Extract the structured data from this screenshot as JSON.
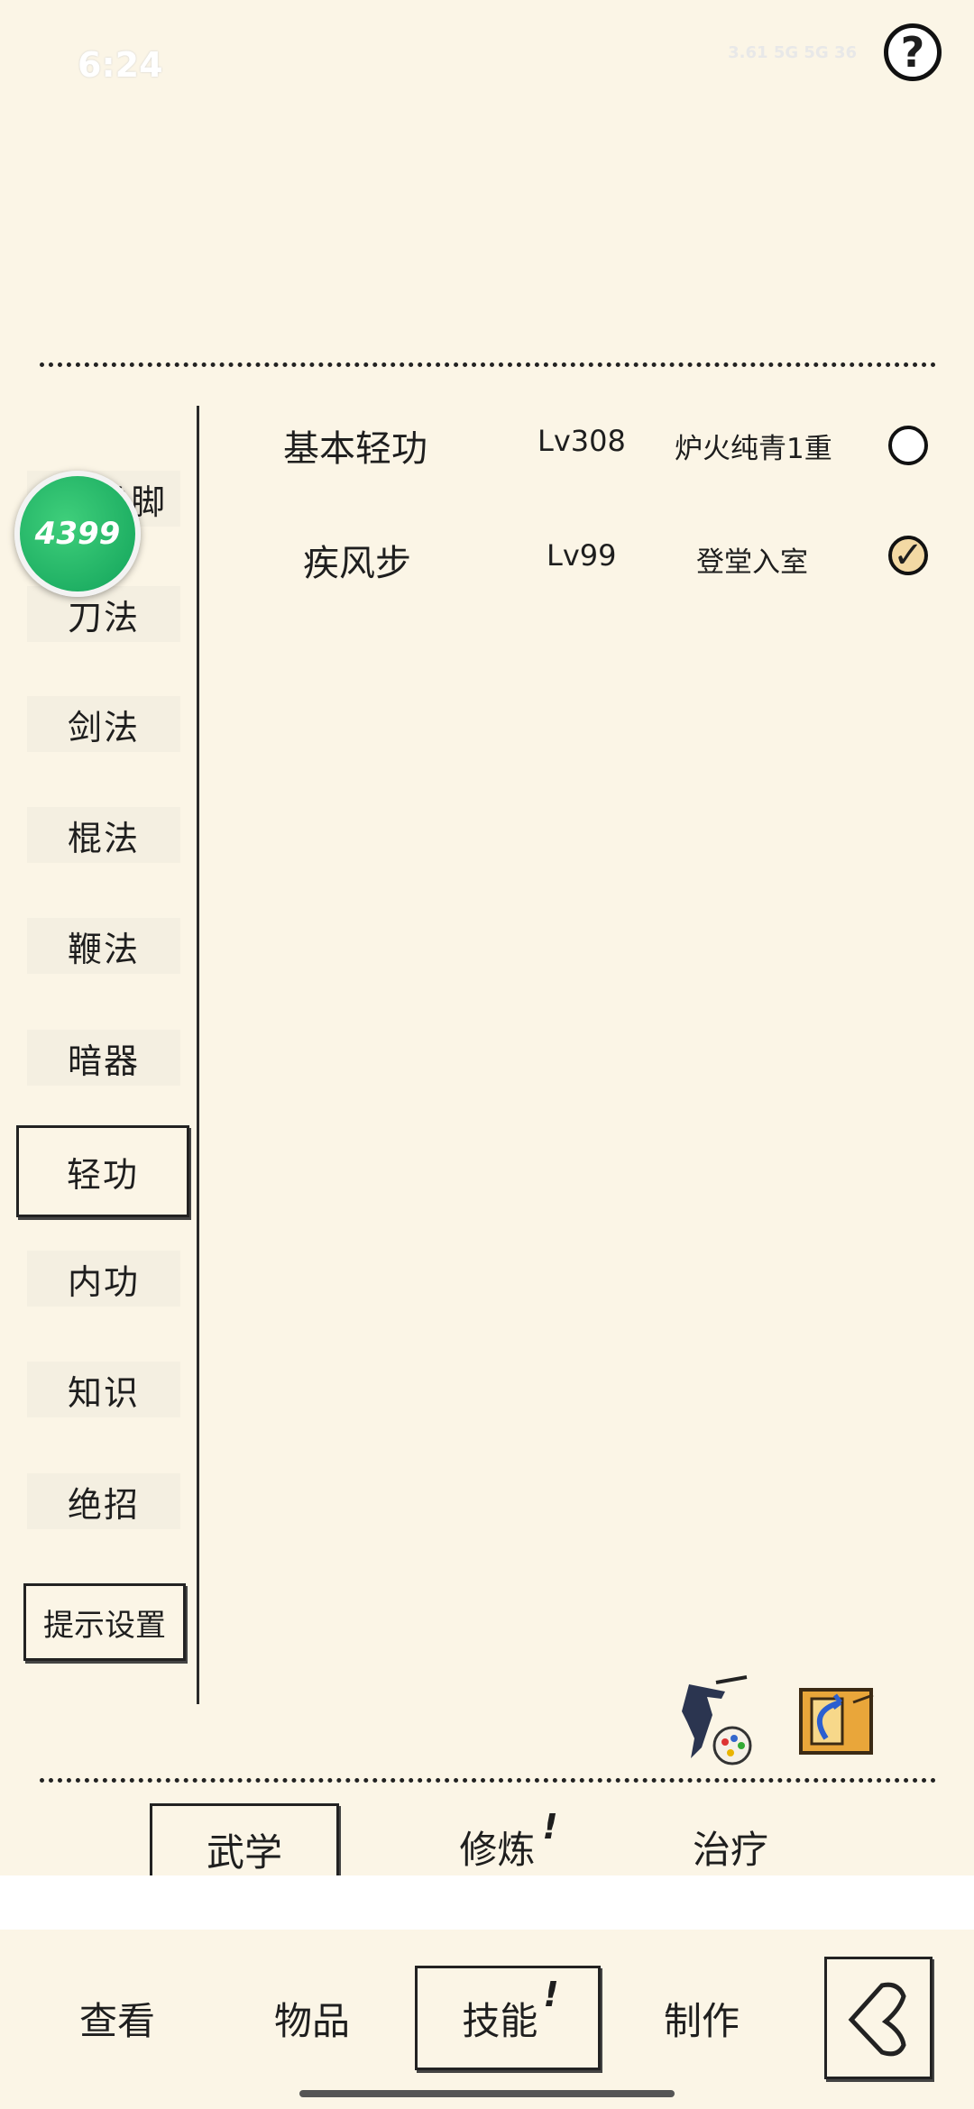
{
  "status": {
    "time": "6:24",
    "signal_text": "3.61 5G  5G  36"
  },
  "help": {
    "label": "?"
  },
  "logo": {
    "text": "4399"
  },
  "sidebar": {
    "items": [
      {
        "label": "拳脚"
      },
      {
        "label": "刀法"
      },
      {
        "label": "剑法"
      },
      {
        "label": "棍法"
      },
      {
        "label": "鞭法"
      },
      {
        "label": "暗器"
      },
      {
        "label": "轻功"
      },
      {
        "label": "内功"
      },
      {
        "label": "知识"
      },
      {
        "label": "绝招"
      }
    ],
    "active_index": 6,
    "tip_button": "提示设置"
  },
  "skills": [
    {
      "name": "基本轻功",
      "level": "Lv308",
      "stage": "炉火纯青1重",
      "checked": false
    },
    {
      "name": "疾风步",
      "level": "Lv99",
      "stage": "登堂入室",
      "checked": true
    }
  ],
  "sub_tabs": [
    {
      "label": "武学",
      "active": true,
      "badge": ""
    },
    {
      "label": "修炼",
      "active": false,
      "badge": "!"
    },
    {
      "label": "治疗",
      "active": false,
      "badge": ""
    }
  ],
  "bottom_nav": [
    {
      "label": "查看",
      "active": false,
      "badge": ""
    },
    {
      "label": "物品",
      "active": false,
      "badge": ""
    },
    {
      "label": "技能",
      "active": true,
      "badge": "!"
    },
    {
      "label": "制作",
      "active": false,
      "badge": ""
    }
  ],
  "icons": {
    "help": "question-icon",
    "ninja": "ninja-icon",
    "palette": "palette-icon",
    "refresh": "refresh-book-icon",
    "back": "back-arrow-icon"
  }
}
